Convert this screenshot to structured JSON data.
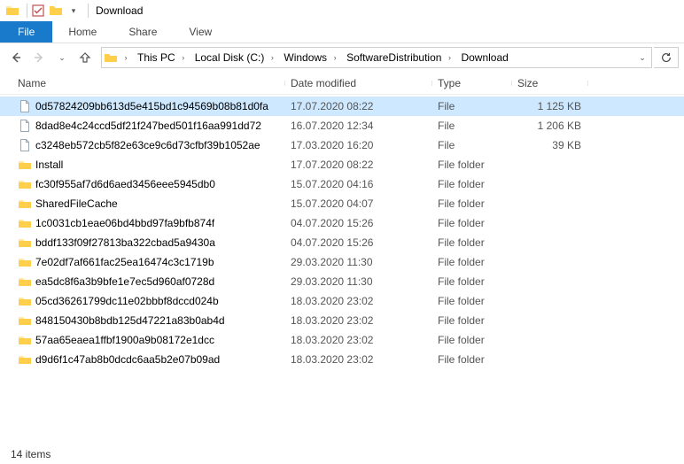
{
  "window": {
    "title": "Download"
  },
  "ribbon": {
    "file": "File",
    "home": "Home",
    "share": "Share",
    "view": "View"
  },
  "breadcrumbs": [
    "This PC",
    "Local Disk (C:)",
    "Windows",
    "SoftwareDistribution",
    "Download"
  ],
  "columns": {
    "name": "Name",
    "date": "Date modified",
    "type": "Type",
    "size": "Size"
  },
  "items": [
    {
      "icon": "file",
      "name": "0d57824209bb613d5e415bd1c94569b08b81d0fa",
      "date": "17.07.2020 08:22",
      "type": "File",
      "size": "1 125 KB",
      "selected": true
    },
    {
      "icon": "file",
      "name": "8dad8e4c24ccd5df21f247bed501f16aa991dd72",
      "date": "16.07.2020 12:34",
      "type": "File",
      "size": "1 206 KB"
    },
    {
      "icon": "file",
      "name": "c3248eb572cb5f82e63ce9c6d73cfbf39b1052ae",
      "date": "17.03.2020 16:20",
      "type": "File",
      "size": "39 KB"
    },
    {
      "icon": "folder",
      "name": "Install",
      "date": "17.07.2020 08:22",
      "type": "File folder",
      "size": ""
    },
    {
      "icon": "folder",
      "name": "fc30f955af7d6d6aed3456eee5945db0",
      "date": "15.07.2020 04:16",
      "type": "File folder",
      "size": ""
    },
    {
      "icon": "folder",
      "name": "SharedFileCache",
      "date": "15.07.2020 04:07",
      "type": "File folder",
      "size": ""
    },
    {
      "icon": "folder",
      "name": "1c0031cb1eae06bd4bbd97fa9bfb874f",
      "date": "04.07.2020 15:26",
      "type": "File folder",
      "size": ""
    },
    {
      "icon": "folder",
      "name": "bddf133f09f27813ba322cbad5a9430a",
      "date": "04.07.2020 15:26",
      "type": "File folder",
      "size": ""
    },
    {
      "icon": "folder",
      "name": "7e02df7af661fac25ea16474c3c1719b",
      "date": "29.03.2020 11:30",
      "type": "File folder",
      "size": ""
    },
    {
      "icon": "folder",
      "name": "ea5dc8f6a3b9bfe1e7ec5d960af0728d",
      "date": "29.03.2020 11:30",
      "type": "File folder",
      "size": ""
    },
    {
      "icon": "folder",
      "name": "05cd36261799dc11e02bbbf8dccd024b",
      "date": "18.03.2020 23:02",
      "type": "File folder",
      "size": ""
    },
    {
      "icon": "folder",
      "name": "848150430b8bdb125d47221a83b0ab4d",
      "date": "18.03.2020 23:02",
      "type": "File folder",
      "size": ""
    },
    {
      "icon": "folder",
      "name": "57aa65eaea1ffbf1900a9b08172e1dcc",
      "date": "18.03.2020 23:02",
      "type": "File folder",
      "size": ""
    },
    {
      "icon": "folder",
      "name": "d9d6f1c47ab8b0dcdc6aa5b2e07b09ad",
      "date": "18.03.2020 23:02",
      "type": "File folder",
      "size": ""
    }
  ],
  "status": {
    "count": "14 items"
  }
}
